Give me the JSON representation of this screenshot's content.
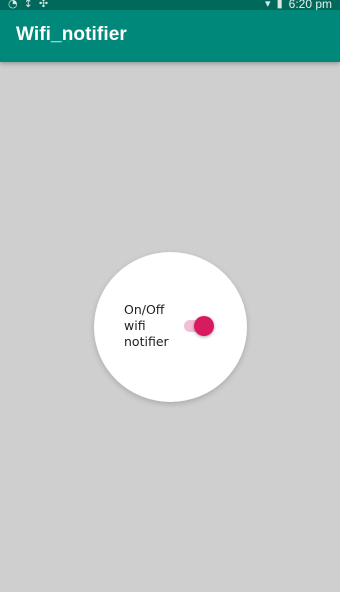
{
  "status_bar": {
    "time": "6:20 pm",
    "icons": [
      "wifi-icon",
      "network-icon",
      "bluetooth-icon",
      "signal-icon",
      "battery-icon"
    ]
  },
  "app_bar": {
    "title": "Wifi_notifier"
  },
  "toggle": {
    "label": "On/Off wifi notifier",
    "checked": true
  },
  "colors": {
    "primary": "#00897B",
    "primary_dark": "#00695C",
    "accent": "#D81B60",
    "track_on": "#F3BFD6",
    "background": "#CFCFCF"
  }
}
